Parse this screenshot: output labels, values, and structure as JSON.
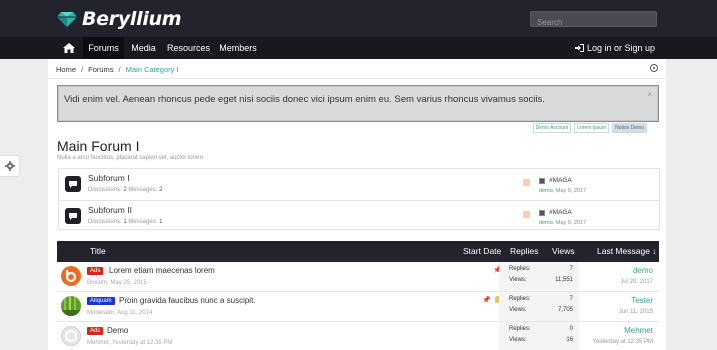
{
  "header": {
    "logo_text": "Beryllium",
    "search_placeholder": "Search"
  },
  "nav": {
    "items": [
      {
        "label": "Forums",
        "active": true
      },
      {
        "label": "Media",
        "active": false
      },
      {
        "label": "Resources",
        "active": false
      },
      {
        "label": "Members",
        "active": false
      }
    ],
    "login": "Log in or Sign up"
  },
  "breadcrumb": {
    "home": "Home",
    "sep": "/",
    "forums": "Forums",
    "current": "Main Category I"
  },
  "notice": {
    "text": "Vidi enim vel. Aenean rhoncus pede eget nisi sociis donec vici ipsum enim eu. Sem varius rhoncus vivamus sociis.",
    "close": "×"
  },
  "demo_tags": [
    "Demo Account",
    "Lorem ipsum",
    "Notice Demo"
  ],
  "forum": {
    "title": "Main Forum I",
    "description": "Nulla a arcu faucibus, placerat sapien vel, auctor lorem"
  },
  "subforums": [
    {
      "name": "Subforum I",
      "discussions_label": "Discussions:",
      "discussions": "2",
      "messages_label": "Messages:",
      "messages": "2",
      "latest_title": "#MAGA",
      "latest_user": "demo",
      "latest_date": "May 9, 2017"
    },
    {
      "name": "Subforum II",
      "discussions_label": "Discussions:",
      "discussions": "1",
      "messages_label": "Messages:",
      "messages": "1",
      "latest_title": "#MAGA",
      "latest_user": "demo",
      "latest_date": "May 9, 2017"
    }
  ],
  "thread_header": {
    "title": "Title",
    "start_date": "Start Date",
    "replies": "Replies",
    "views": "Views",
    "last_message": "Last Message ↓"
  },
  "threads": [
    {
      "label": "Ads",
      "label_color": "#d9261c",
      "title": "Lorem etiam maecenas lorem",
      "author": "Brixium",
      "date": "May 25, 2015",
      "replies_label": "Replies:",
      "replies": "7",
      "views_label": "Views:",
      "views": "11,551",
      "last_user": "demo",
      "last_date": "Jul 20, 2017"
    },
    {
      "label": "Aliquam",
      "label_color": "#1a36c9",
      "title": "Proin gravida faucibus nunc a suscipit.",
      "author": "Moderator",
      "date": "Aug 11, 2014",
      "replies_label": "Replies:",
      "replies": "7",
      "views_label": "Views:",
      "views": "7,705",
      "last_user": "Tester",
      "last_date": "Jun 11, 2015"
    },
    {
      "label": "Ads",
      "label_color": "#d9261c",
      "title": "Demo",
      "author": "Mehmet",
      "date": "Yesterday at 12:35 PM",
      "replies_label": "Replies:",
      "replies": "0",
      "views_label": "Views:",
      "views": "16",
      "last_user": "Mehmet",
      "last_date": "Yesterday at 12:35 PM"
    }
  ],
  "colors": {
    "accent": "#3a9d98",
    "header_bg": "#23232d",
    "nav_bg": "#18181f"
  }
}
